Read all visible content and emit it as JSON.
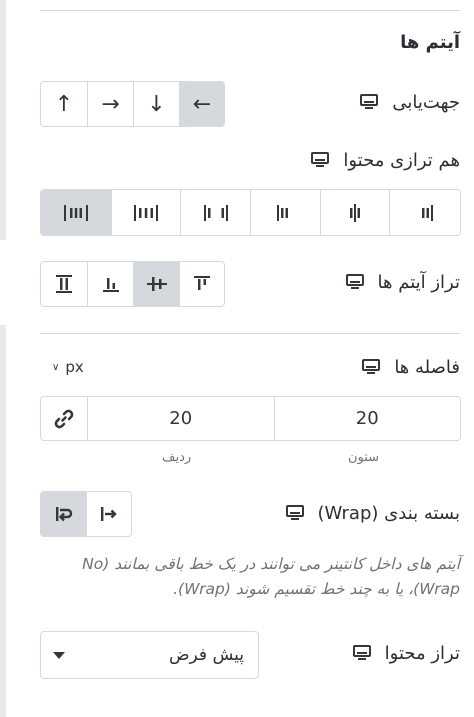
{
  "items_section": {
    "title": "آیتم ها"
  },
  "direction": {
    "label": "جهت‌یابی",
    "buttons": [
      {
        "icon": "arrow-up-icon",
        "glyph": "↑"
      },
      {
        "icon": "arrow-right-icon",
        "glyph": "→"
      },
      {
        "icon": "arrow-down-icon",
        "glyph": "↓"
      },
      {
        "icon": "arrow-left-icon",
        "glyph": "←",
        "active": true
      }
    ]
  },
  "justify_content": {
    "label": "هم ترازی محتوا",
    "active_index": 0,
    "buttons": [
      "justify-space-evenly-icon",
      "justify-space-around-icon",
      "justify-space-between-icon",
      "justify-end-icon",
      "justify-center-icon",
      "justify-start-icon"
    ]
  },
  "align_items": {
    "label": "تراز آیتم ها",
    "active_index": 2,
    "buttons": [
      "align-stretch-icon",
      "align-end-icon",
      "align-center-icon",
      "align-start-icon"
    ]
  },
  "gaps": {
    "label": "فاصله ها",
    "unit": "px",
    "column_value": "20",
    "row_value": "20",
    "column_label": "ستون",
    "row_label": "ردیف"
  },
  "wrap": {
    "label": "بسته بندی (Wrap)",
    "buttons": [
      "wrap-icon",
      "no-wrap-icon"
    ],
    "active_index": 0,
    "description": "آیتم های داخل کانتینر می توانند در یک خط باقی بمانند (No Wrap)، یا به چند خط تقسیم شوند (Wrap)."
  },
  "align_content": {
    "label": "تراز محتوا",
    "selected": "پیش فرض"
  },
  "colors": {
    "border": "#d5d8dc",
    "active": "#d5d8dc",
    "text": "#2b2f33",
    "muted": "#6d7378"
  }
}
